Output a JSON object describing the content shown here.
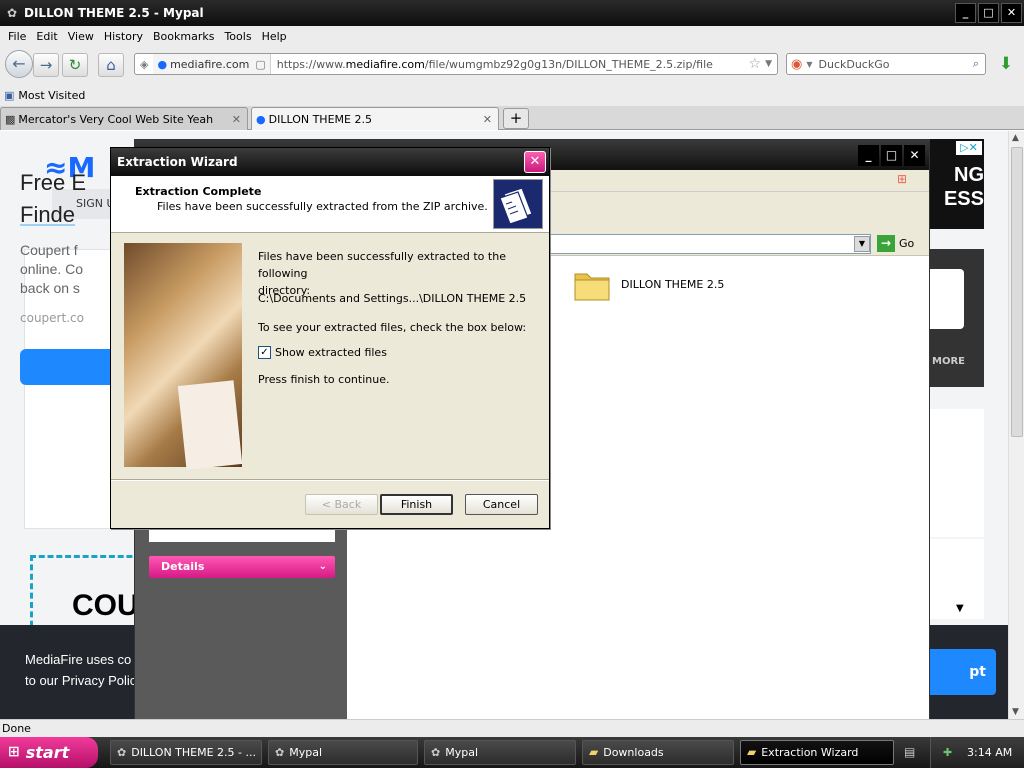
{
  "browser": {
    "title": "DILLON THEME 2.5 - Mypal",
    "window_buttons": [
      "_",
      "□",
      "✕"
    ],
    "menu": [
      "File",
      "Edit",
      "View",
      "History",
      "Bookmarks",
      "Tools",
      "Help"
    ],
    "site_identity": "mediafire.com",
    "url_prefix": "https://www.",
    "url_domain": "mediafire.com",
    "url_path": "/file/wumgmbz92g0g13n/DILLON_THEME_2.5.zip/file",
    "search_placeholder": "DuckDuckGo",
    "bookmarks": [
      "Most Visited"
    ],
    "tabs": [
      {
        "label": "Mercator's Very Cool Web Site Yeah"
      },
      {
        "label": "DILLON THEME 2.5"
      }
    ],
    "new_tab": "+",
    "status": "Done"
  },
  "page": {
    "logo": "M",
    "signup": "SIGN U",
    "ad_title_line1": "Free E",
    "ad_title_line2": "Finde",
    "ad_text_line1": "Coupert f",
    "ad_text_line2": "online. Co",
    "ad_text_line3": "back on s",
    "ad_domain": "coupert.co",
    "dashed_text": "COU",
    "right_ad_text": "NG\nESS",
    "right_more": "MORE",
    "cookie_line1": "MediaFire uses co",
    "cookie_line2": "to our Privacy Polic",
    "accept": "pt"
  },
  "folder_window": {
    "go_label": "Go",
    "folder_name": "DILLON THEME 2.5",
    "details": "Details"
  },
  "wizard": {
    "title": "Extraction Wizard",
    "header_title": "Extraction Complete",
    "header_subtitle": "Files have been successfully extracted from the ZIP archive.",
    "msg_line1": "Files have been successfully extracted to the following",
    "msg_line2": "directory:",
    "path": "C:\\Documents and Settings...\\DILLON THEME 2.5",
    "check_hint": "To see your extracted files, check the box below:",
    "checkbox_label": "Show extracted files",
    "checkbox_checked": true,
    "finish_hint": "Press finish to continue.",
    "back": "< Back",
    "finish": "Finish",
    "cancel": "Cancel"
  },
  "taskbar": {
    "start": "start",
    "tasks": [
      {
        "label": "DILLON THEME 2.5 - ...",
        "icon": "mypal-icon"
      },
      {
        "label": "Mypal",
        "icon": "mypal-icon"
      },
      {
        "label": "Mypal",
        "icon": "mypal-icon"
      },
      {
        "label": "Downloads",
        "icon": "folder-icon"
      },
      {
        "label": "Extraction Wizard",
        "icon": "folder-icon",
        "active": true
      }
    ],
    "clock": "3:14 AM"
  }
}
